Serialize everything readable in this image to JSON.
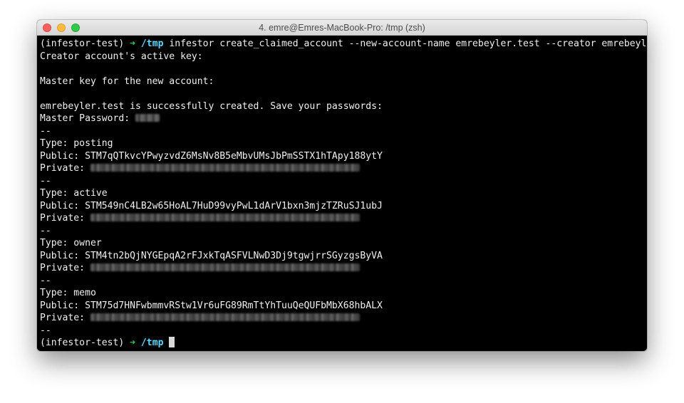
{
  "window": {
    "title": "4. emre@Emres-MacBook-Pro: /tmp (zsh)"
  },
  "prompt": {
    "env": "(infestor-test)",
    "arrow": "➜",
    "cwd": "/tmp"
  },
  "terminal": {
    "command": "infestor create_claimed_account --new-account-name emrebeyler.test --creator emrebeyler",
    "creator_key_prompt": "Creator account's active key:",
    "master_key_prompt": "Master key for the new account:",
    "success_message": "emrebeyler.test is successfully created. Save your passwords:",
    "master_password_label": "Master Password:",
    "separator": "--",
    "keys": [
      {
        "type_line": "Type: posting",
        "public_line": "Public: STM7qQTkvcYPwyzvdZ6MsNv8B5eMbvUMsJbPmSSTX1hTApy188ytY",
        "private_label": "Private:"
      },
      {
        "type_line": "Type: active",
        "public_line": "Public: STM549nC4LB2w65HoAL7HuD99vyPwL1dArV1bxn3mjzTZRuSJ1ubJ",
        "private_label": "Private:"
      },
      {
        "type_line": "Type: owner",
        "public_line": "Public: STM4tn2bQjNYGEpqA2rFJxkTqASFVLNwD3Dj9tgwjrrSGyzgsByVA",
        "private_label": "Private:"
      },
      {
        "type_line": "Type: memo",
        "public_line": "Public: STM75d7HNFwbmmvRStw1Vr6uFG89RmTtYhTuuQeQUFbMbX68hbALX",
        "private_label": "Private:"
      }
    ]
  }
}
